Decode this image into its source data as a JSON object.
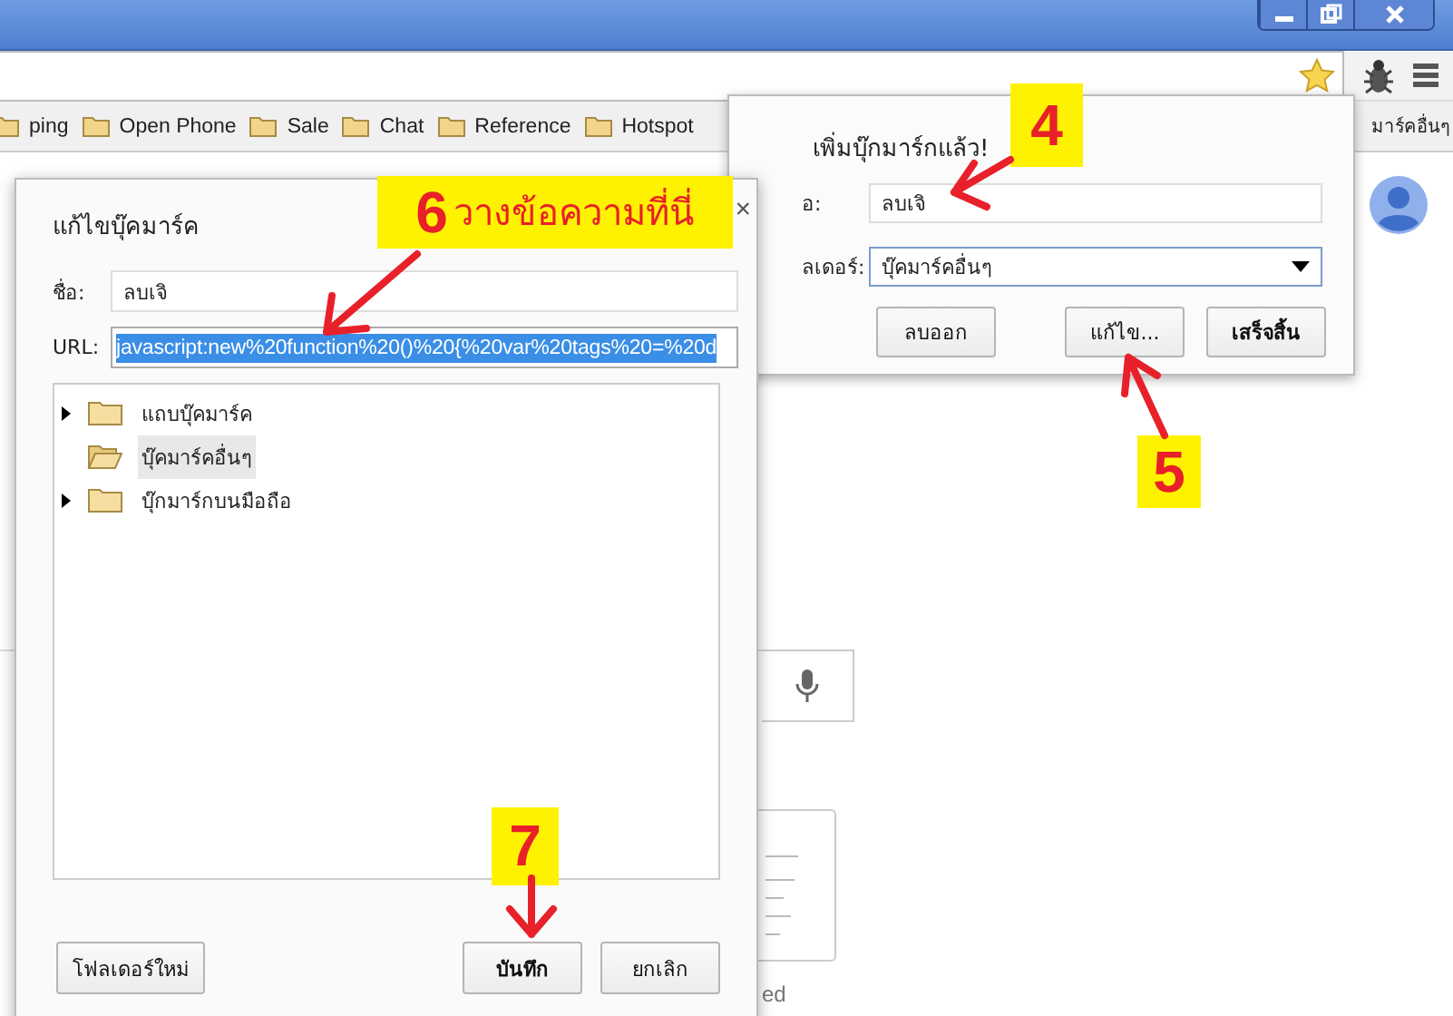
{
  "bookmarks_bar": {
    "items": [
      {
        "label": "ping"
      },
      {
        "label": "Open Phone"
      },
      {
        "label": "Sale"
      },
      {
        "label": "Chat"
      },
      {
        "label": "Reference"
      },
      {
        "label": "Hotspot"
      }
    ],
    "other_bookmarks": "มาร์คอื่นๆ"
  },
  "background_page": {
    "caption": "ed"
  },
  "bookmark_added_popup": {
    "title": "เพิ่มบุ๊กมาร์กแล้ว!",
    "name_label": "อ:",
    "name_value": "ลบเจิ",
    "folder_label": "ลเดอร์:",
    "folder_value": "บุ๊คมาร์คอื่นๆ",
    "buttons": [
      {
        "label": "ลบออก",
        "default": false
      },
      {
        "label": "แก้ไข...",
        "default": false
      },
      {
        "label": "เสร็จสิ้น",
        "default": true
      }
    ]
  },
  "edit_bookmark_dialog": {
    "title": "แก้ไขบุ๊คมาร์ค",
    "close": "×",
    "name_label": "ชื่อ:",
    "name_value": "ลบเจิ",
    "url_label": "URL:",
    "url_value": "javascript:new%20function%20()%20{%20var%20tags%20=%20d",
    "folders": [
      {
        "label": "แถบบุ๊คมาร์ค",
        "expanded": false,
        "selected": false
      },
      {
        "label": "บุ๊คมาร์คอื่นๆ",
        "expanded": true,
        "selected": true
      },
      {
        "label": "บุ๊กมาร์กบนมือถือ",
        "expanded": false,
        "selected": false
      }
    ],
    "buttons": [
      {
        "label": "โฟลเดอร์ใหม่",
        "default": false
      },
      {
        "label": "บันทึก",
        "default": true
      },
      {
        "label": "ยกเลิก",
        "default": false
      }
    ]
  },
  "annotations": [
    {
      "number": "6",
      "text": "วางข้อความที่นี่"
    },
    {
      "number": "4"
    },
    {
      "number": "5"
    },
    {
      "number": "7"
    }
  ]
}
